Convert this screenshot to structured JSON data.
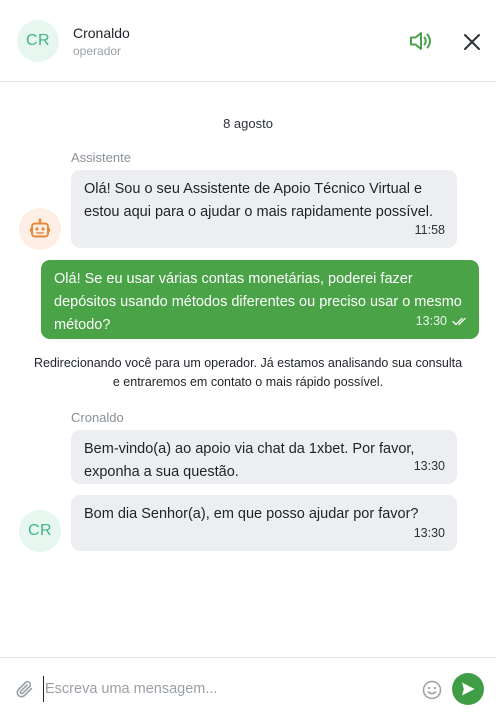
{
  "header": {
    "avatar_initials": "CR",
    "agent_name": "Cronaldo",
    "agent_role": "operador"
  },
  "conversation": {
    "date": "8 agosto",
    "assistant": {
      "label": "Assistente",
      "message": "Olá! Sou o seu Assistente de Apoio Técnico Virtual e estou aqui para o ajudar o mais rapidamente possível.",
      "time": "11:58"
    },
    "user_message": {
      "text": "Olá! Se eu usar várias contas monetárias, poderei fazer depósitos usando métodos diferentes ou preciso usar o mesmo método?",
      "time": "13:30"
    },
    "system_notice": "Redirecionando você para um operador. Já estamos analisando sua consulta e entraremos em contato o mais rápido possível.",
    "operator": {
      "label": "Cronaldo",
      "avatar_initials": "CR",
      "messages": [
        {
          "text": "Bem-vindo(a) ao apoio via chat da 1xbet. Por favor, exponha a sua questão.",
          "time": "13:30"
        },
        {
          "text": "Bom dia Senhor(a), em que posso ajudar por favor?",
          "time": "13:30"
        }
      ]
    }
  },
  "composer": {
    "placeholder": "Escreva uma mensagem...",
    "value": ""
  },
  "colors": {
    "accent_green": "#4aa347",
    "avatar_bg": "#e7f7f0",
    "avatar_text": "#3fb48a",
    "bot_avatar_bg": "#fdefe6",
    "bot_icon": "#e8883a",
    "incoming_bubble": "#eceef1"
  },
  "icons": {
    "sound": "speaker-icon",
    "close": "close-icon",
    "bot": "robot-icon",
    "read": "double-check-icon",
    "attach": "paperclip-icon",
    "emoji": "smiley-icon",
    "send": "send-icon"
  }
}
